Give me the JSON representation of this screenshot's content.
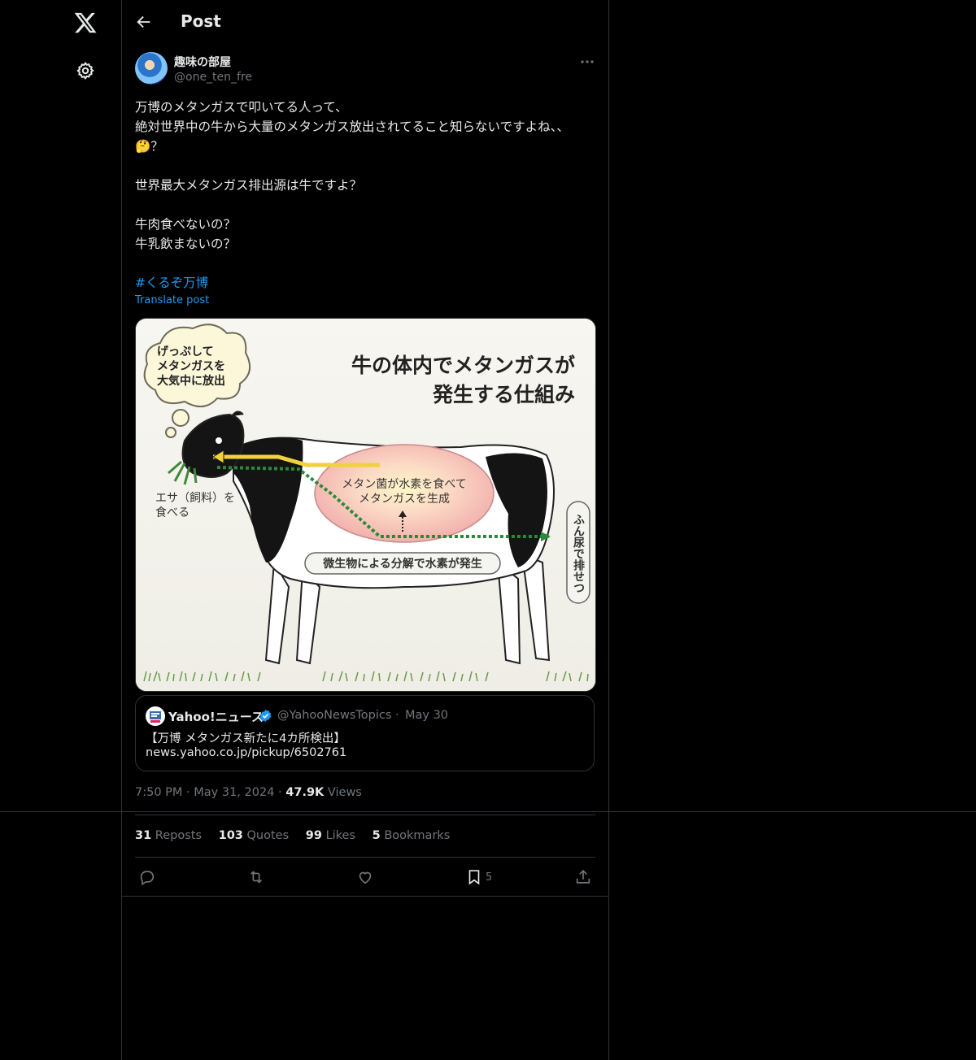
{
  "header": {
    "title": "Post"
  },
  "post": {
    "display_name": "趣味の部屋",
    "handle": "@one_ten_fre",
    "text": "万博のメタンガスで叩いてる人って、\n絶対世界中の牛から大量のメタンガス放出されてること知らないですよね、、🤔？\n\n世界最大メタンガス排出源は牛ですよ？\n\n牛肉食べないの？\n牛乳飲まないの？",
    "hashtag": "#くるぞ万博",
    "translate_label": "Translate post",
    "time": "7:50 PM",
    "date": "May 31, 2024",
    "views_count": "47.9K",
    "views_label": "Views"
  },
  "image": {
    "title_line1": "牛の体内でメタンガスが",
    "title_line2": "発生する仕組み",
    "bubble_line1": "げっぷして",
    "bubble_line2": "メタンガスを",
    "bubble_line3": "大気中に放出",
    "feed_line1": "エサ（飼料）を",
    "feed_line2": "食べる",
    "stomach_line1": "メタン菌が水素を食べて",
    "stomach_line2": "メタンガスを生成",
    "bottom_label": "微生物による分解で水素が発生",
    "side_label": "ふん尿で排せつ"
  },
  "quote": {
    "name": "Yahoo!ニュース",
    "handle": "@YahooNewsTopics",
    "separator": "·",
    "date": "May 30",
    "line1": "【万博 メタンガス新たに4カ所検出】",
    "line2": "news.yahoo.co.jp/pickup/6502761"
  },
  "stats": {
    "reposts_count": "31",
    "reposts_label": "Reposts",
    "quotes_count": "103",
    "quotes_label": "Quotes",
    "likes_count": "99",
    "likes_label": "Likes",
    "bookmarks_count": "5",
    "bookmarks_label": "Bookmarks"
  },
  "actions": {
    "bookmark_count": "5"
  },
  "colors": {
    "background": "#000000",
    "text": "#e7e9ea",
    "muted": "#71767b",
    "accent": "#1d9bf0",
    "border": "#2f3336"
  }
}
